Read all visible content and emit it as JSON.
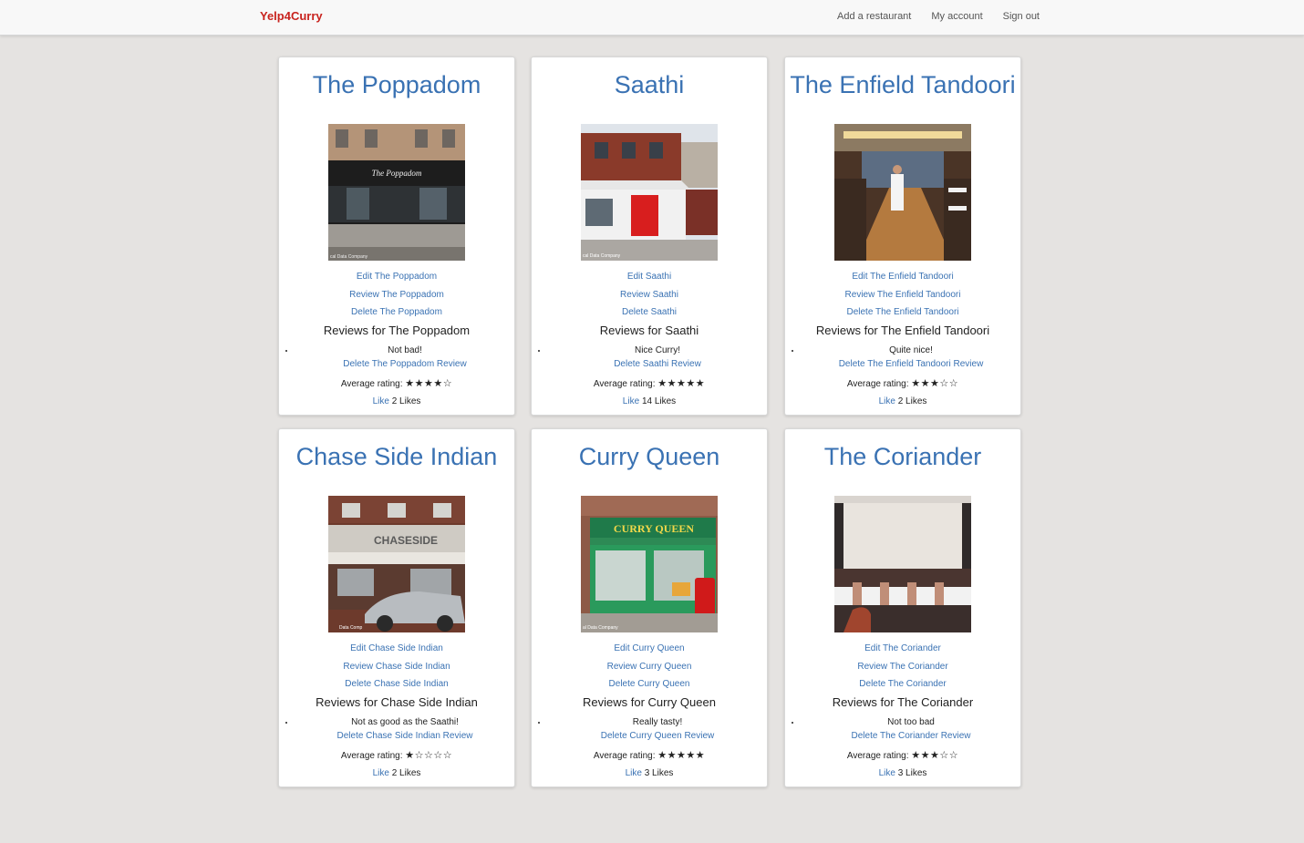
{
  "navbar": {
    "brand": "Yelp4Curry",
    "links": [
      "Add a restaurant",
      "My account",
      "Sign out"
    ]
  },
  "restaurants": [
    {
      "name": "The Poppadom",
      "edit": "Edit The Poppadom",
      "review": "Review The Poppadom",
      "delete": "Delete The Poppadom",
      "reviews_heading": "Reviews for The Poppadom",
      "review_text": "Not bad!",
      "review_delete": "Delete The Poppadom Review",
      "avg_label": "Average rating:",
      "stars": "★★★★☆",
      "like_label": "Like",
      "likes_count": "2 Likes",
      "photo_sign": "The Poppadom",
      "photo_credit": "cal Data Company"
    },
    {
      "name": "Saathi",
      "edit": "Edit Saathi",
      "review": "Review Saathi",
      "delete": "Delete Saathi",
      "reviews_heading": "Reviews for Saathi",
      "review_text": "Nice Curry!",
      "review_delete": "Delete Saathi Review",
      "avg_label": "Average rating:",
      "stars": "★★★★★",
      "like_label": "Like",
      "likes_count": "14 Likes",
      "photo_sign": "",
      "photo_credit": "cal Data Company"
    },
    {
      "name": "The Enfield Tandoori",
      "edit": "Edit The Enfield Tandoori",
      "review": "Review The Enfield Tandoori",
      "delete": "Delete The Enfield Tandoori",
      "reviews_heading": "Reviews for The Enfield Tandoori",
      "review_text": "Quite nice!",
      "review_delete": "Delete The Enfield Tandoori Review",
      "avg_label": "Average rating:",
      "stars": "★★★☆☆",
      "like_label": "Like",
      "likes_count": "2 Likes",
      "photo_sign": "",
      "photo_credit": ""
    },
    {
      "name": "Chase Side Indian",
      "edit": "Edit Chase Side Indian",
      "review": "Review Chase Side Indian",
      "delete": "Delete Chase Side Indian",
      "reviews_heading": "Reviews for Chase Side Indian",
      "review_text": "Not as good as the Saathi!",
      "review_delete": "Delete Chase Side Indian Review",
      "avg_label": "Average rating:",
      "stars": "★☆☆☆☆",
      "like_label": "Like",
      "likes_count": "2 Likes",
      "photo_sign": "CHASESIDE",
      "photo_credit": "Data Comp"
    },
    {
      "name": "Curry Queen",
      "edit": "Edit Curry Queen",
      "review": "Review Curry Queen",
      "delete": "Delete Curry Queen",
      "reviews_heading": "Reviews for Curry Queen",
      "review_text": "Really tasty!",
      "review_delete": "Delete Curry Queen Review",
      "avg_label": "Average rating:",
      "stars": "★★★★★",
      "like_label": "Like",
      "likes_count": "3 Likes",
      "photo_sign": "CURRY QUEEN",
      "photo_credit": "al Data Company"
    },
    {
      "name": "The Coriander",
      "edit": "Edit The Coriander",
      "review": "Review The Coriander",
      "delete": "Delete The Coriander",
      "reviews_heading": "Reviews for The Coriander",
      "review_text": "Not too bad",
      "review_delete": "Delete The Coriander Review",
      "avg_label": "Average rating:",
      "stars": "★★★☆☆",
      "like_label": "Like",
      "likes_count": "3 Likes",
      "photo_sign": "",
      "photo_credit": ""
    }
  ]
}
